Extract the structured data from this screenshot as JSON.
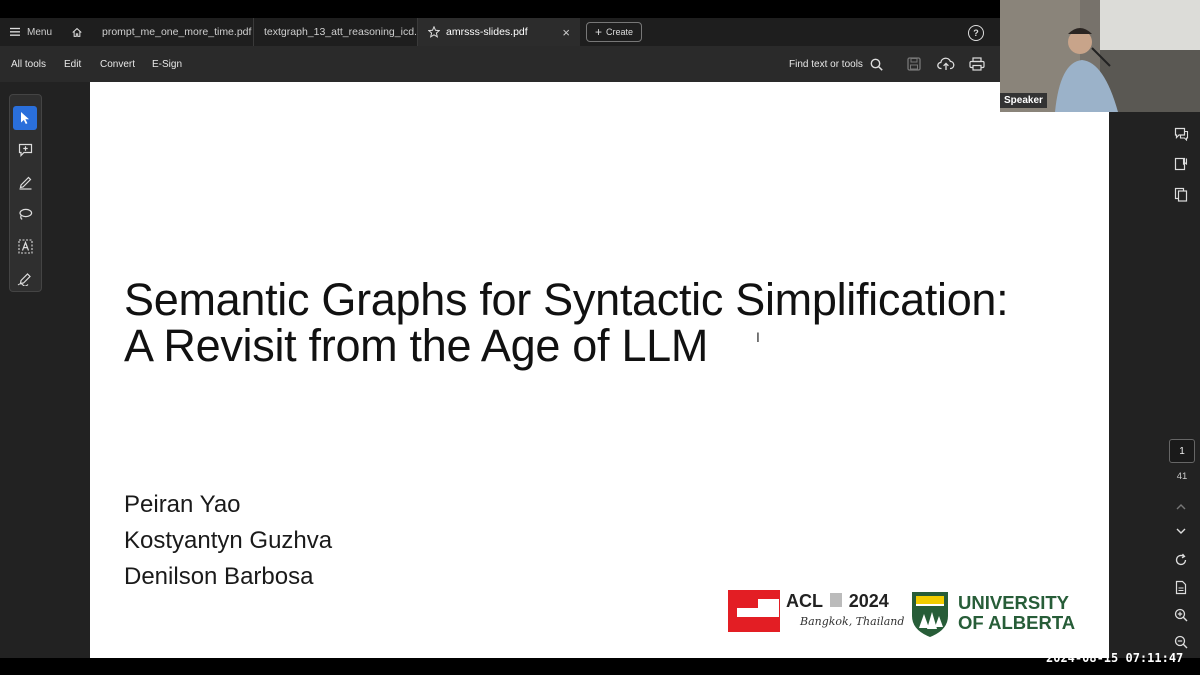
{
  "tabs": {
    "menu_label": "Menu",
    "items": [
      {
        "label": "prompt_me_one_more_time.pdf"
      },
      {
        "label": "textgraph_13_att_reasoning_icd..."
      },
      {
        "label": "amrsss-slides.pdf",
        "active": true
      }
    ],
    "create_label": "Create"
  },
  "toolbar": {
    "all_tools": "All tools",
    "edit": "Edit",
    "convert": "Convert",
    "esign": "E-Sign",
    "find": "Find text or tools"
  },
  "slide": {
    "title_line1": "Semantic Graphs for Syntactic Simplification:",
    "title_line2": "A Revisit from the Age of LLM",
    "authors": [
      "Peiran Yao",
      "Kostyantyn Guzhva",
      "Denilson Barbosa"
    ],
    "acl_text": "ACL",
    "acl_year": "2024",
    "acl_location": "Bangkok, Thailand",
    "ua_line1": "UNIVERSITY",
    "ua_line2": "OF ALBERTA"
  },
  "pagination": {
    "current": "1",
    "total": "41"
  },
  "webcam": {
    "label": "Speaker"
  },
  "timestamp": "2024-08-15 07:11:47",
  "colors": {
    "accent": "#2a6fdb",
    "acl_red": "#e31e24",
    "ua_green": "#275d38",
    "ua_gold": "#f2cd00"
  }
}
